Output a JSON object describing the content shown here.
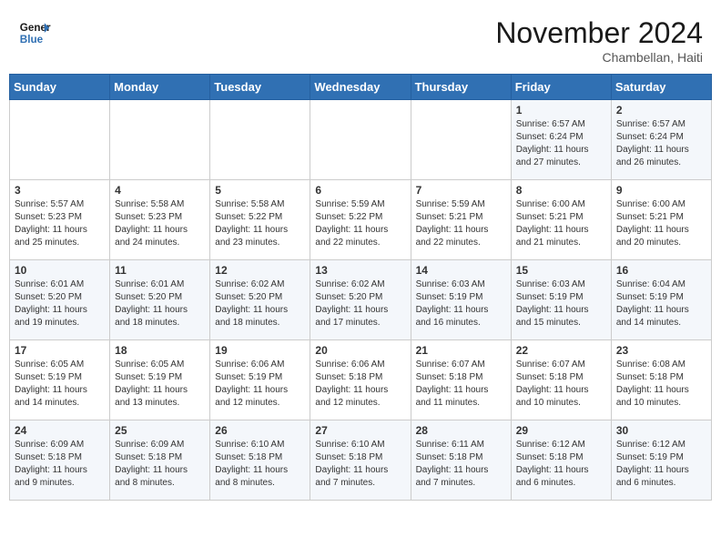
{
  "header": {
    "logo_line1": "General",
    "logo_line2": "Blue",
    "month_year": "November 2024",
    "location": "Chambellan, Haiti"
  },
  "days_of_week": [
    "Sunday",
    "Monday",
    "Tuesday",
    "Wednesday",
    "Thursday",
    "Friday",
    "Saturday"
  ],
  "weeks": [
    [
      {
        "day": "",
        "content": ""
      },
      {
        "day": "",
        "content": ""
      },
      {
        "day": "",
        "content": ""
      },
      {
        "day": "",
        "content": ""
      },
      {
        "day": "",
        "content": ""
      },
      {
        "day": "1",
        "content": "Sunrise: 6:57 AM\nSunset: 6:24 PM\nDaylight: 11 hours\nand 27 minutes."
      },
      {
        "day": "2",
        "content": "Sunrise: 6:57 AM\nSunset: 6:24 PM\nDaylight: 11 hours\nand 26 minutes."
      }
    ],
    [
      {
        "day": "3",
        "content": "Sunrise: 5:57 AM\nSunset: 5:23 PM\nDaylight: 11 hours\nand 25 minutes."
      },
      {
        "day": "4",
        "content": "Sunrise: 5:58 AM\nSunset: 5:23 PM\nDaylight: 11 hours\nand 24 minutes."
      },
      {
        "day": "5",
        "content": "Sunrise: 5:58 AM\nSunset: 5:22 PM\nDaylight: 11 hours\nand 23 minutes."
      },
      {
        "day": "6",
        "content": "Sunrise: 5:59 AM\nSunset: 5:22 PM\nDaylight: 11 hours\nand 22 minutes."
      },
      {
        "day": "7",
        "content": "Sunrise: 5:59 AM\nSunset: 5:21 PM\nDaylight: 11 hours\nand 22 minutes."
      },
      {
        "day": "8",
        "content": "Sunrise: 6:00 AM\nSunset: 5:21 PM\nDaylight: 11 hours\nand 21 minutes."
      },
      {
        "day": "9",
        "content": "Sunrise: 6:00 AM\nSunset: 5:21 PM\nDaylight: 11 hours\nand 20 minutes."
      }
    ],
    [
      {
        "day": "10",
        "content": "Sunrise: 6:01 AM\nSunset: 5:20 PM\nDaylight: 11 hours\nand 19 minutes."
      },
      {
        "day": "11",
        "content": "Sunrise: 6:01 AM\nSunset: 5:20 PM\nDaylight: 11 hours\nand 18 minutes."
      },
      {
        "day": "12",
        "content": "Sunrise: 6:02 AM\nSunset: 5:20 PM\nDaylight: 11 hours\nand 18 minutes."
      },
      {
        "day": "13",
        "content": "Sunrise: 6:02 AM\nSunset: 5:20 PM\nDaylight: 11 hours\nand 17 minutes."
      },
      {
        "day": "14",
        "content": "Sunrise: 6:03 AM\nSunset: 5:19 PM\nDaylight: 11 hours\nand 16 minutes."
      },
      {
        "day": "15",
        "content": "Sunrise: 6:03 AM\nSunset: 5:19 PM\nDaylight: 11 hours\nand 15 minutes."
      },
      {
        "day": "16",
        "content": "Sunrise: 6:04 AM\nSunset: 5:19 PM\nDaylight: 11 hours\nand 14 minutes."
      }
    ],
    [
      {
        "day": "17",
        "content": "Sunrise: 6:05 AM\nSunset: 5:19 PM\nDaylight: 11 hours\nand 14 minutes."
      },
      {
        "day": "18",
        "content": "Sunrise: 6:05 AM\nSunset: 5:19 PM\nDaylight: 11 hours\nand 13 minutes."
      },
      {
        "day": "19",
        "content": "Sunrise: 6:06 AM\nSunset: 5:19 PM\nDaylight: 11 hours\nand 12 minutes."
      },
      {
        "day": "20",
        "content": "Sunrise: 6:06 AM\nSunset: 5:18 PM\nDaylight: 11 hours\nand 12 minutes."
      },
      {
        "day": "21",
        "content": "Sunrise: 6:07 AM\nSunset: 5:18 PM\nDaylight: 11 hours\nand 11 minutes."
      },
      {
        "day": "22",
        "content": "Sunrise: 6:07 AM\nSunset: 5:18 PM\nDaylight: 11 hours\nand 10 minutes."
      },
      {
        "day": "23",
        "content": "Sunrise: 6:08 AM\nSunset: 5:18 PM\nDaylight: 11 hours\nand 10 minutes."
      }
    ],
    [
      {
        "day": "24",
        "content": "Sunrise: 6:09 AM\nSunset: 5:18 PM\nDaylight: 11 hours\nand 9 minutes."
      },
      {
        "day": "25",
        "content": "Sunrise: 6:09 AM\nSunset: 5:18 PM\nDaylight: 11 hours\nand 8 minutes."
      },
      {
        "day": "26",
        "content": "Sunrise: 6:10 AM\nSunset: 5:18 PM\nDaylight: 11 hours\nand 8 minutes."
      },
      {
        "day": "27",
        "content": "Sunrise: 6:10 AM\nSunset: 5:18 PM\nDaylight: 11 hours\nand 7 minutes."
      },
      {
        "day": "28",
        "content": "Sunrise: 6:11 AM\nSunset: 5:18 PM\nDaylight: 11 hours\nand 7 minutes."
      },
      {
        "day": "29",
        "content": "Sunrise: 6:12 AM\nSunset: 5:18 PM\nDaylight: 11 hours\nand 6 minutes."
      },
      {
        "day": "30",
        "content": "Sunrise: 6:12 AM\nSunset: 5:19 PM\nDaylight: 11 hours\nand 6 minutes."
      }
    ]
  ]
}
